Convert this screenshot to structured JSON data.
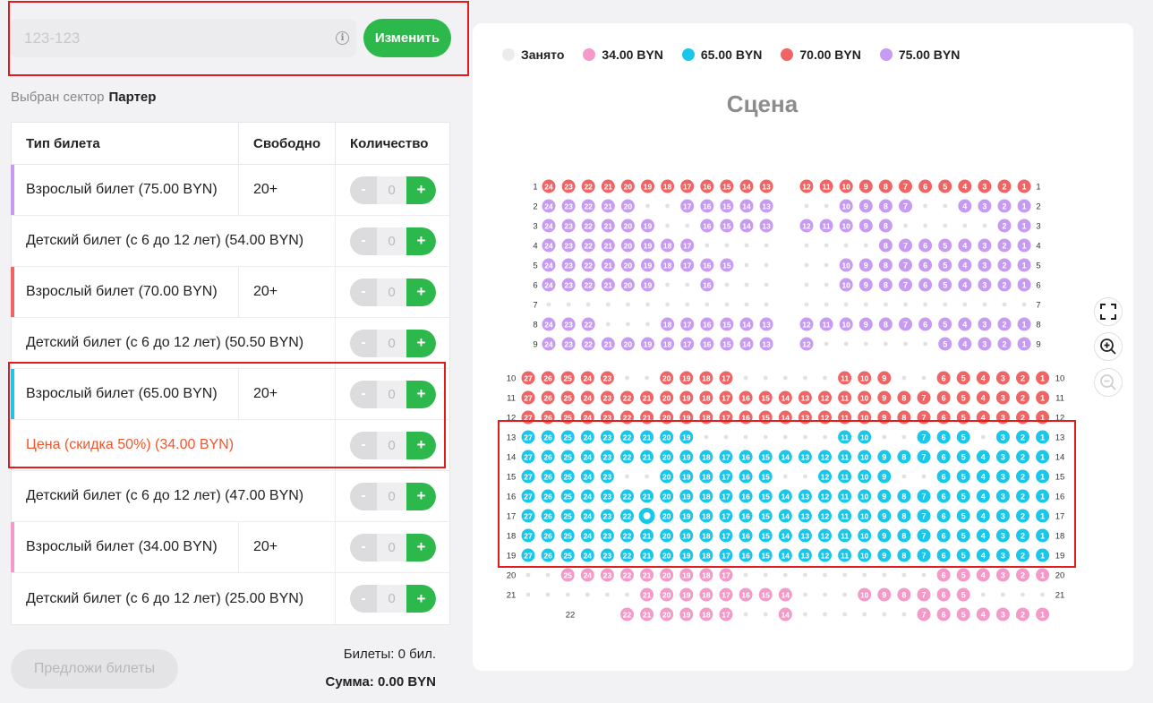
{
  "code_input": {
    "placeholder": "123-123",
    "value": ""
  },
  "change_button": "Изменить",
  "sector": {
    "label": "Выбран сектор",
    "value": "Партер"
  },
  "table": {
    "headers": {
      "type": "Тип билета",
      "free": "Свободно",
      "qty": "Количество"
    },
    "rows": [
      {
        "label": "Взрослый билет (75.00 BYN)",
        "free": "20+",
        "qty": "0",
        "kind": "main",
        "accent": "#c79bf2"
      },
      {
        "label": "Детский билет (с 6 до 12 лет) (54.00 BYN)",
        "qty": "0",
        "kind": "sub"
      },
      {
        "label": "Взрослый билет (70.00 BYN)",
        "free": "20+",
        "qty": "0",
        "kind": "main",
        "accent": "#f06464"
      },
      {
        "label": "Детский билет (с 6 до 12 лет) (50.50 BYN)",
        "qty": "0",
        "kind": "sub"
      },
      {
        "label": "Взрослый билет (65.00 BYN)",
        "free": "20+",
        "qty": "0",
        "kind": "main",
        "accent": "#19c7ea"
      },
      {
        "label": "Цена (скидка 50%) (34.00 BYN)",
        "qty": "0",
        "kind": "sub",
        "discount": true
      },
      {
        "label": "Детский билет (с 6 до 12 лет) (47.00 BYN)",
        "qty": "0",
        "kind": "sub"
      },
      {
        "label": "Взрослый билет (34.00 BYN)",
        "free": "20+",
        "qty": "0",
        "kind": "main",
        "accent": "#f49ac9"
      },
      {
        "label": "Детский билет (с 6 до 12 лет) (25.00 BYN)",
        "qty": "0",
        "kind": "sub"
      }
    ],
    "minus": "-",
    "plus": "+"
  },
  "offer_button": "Предложи билеты",
  "summary": {
    "tickets": "Билеты: 0 бил.",
    "sum": "Сумма: 0.00 BYN"
  },
  "legend": [
    {
      "label": "Занято",
      "color": "#ececee"
    },
    {
      "label": "34.00 BYN",
      "color": "#f49ac9"
    },
    {
      "label": "65.00 BYN",
      "color": "#19c7ea"
    },
    {
      "label": "70.00 BYN",
      "color": "#f06464"
    },
    {
      "label": "75.00 BYN",
      "color": "#c79bf2"
    }
  ],
  "stage": "Сцена",
  "colors": {
    "taken": "#e2e2e4",
    "purple": "#c79bf2",
    "red": "#f06464",
    "cyan": "#19c7ea",
    "pink": "#f49ac9",
    "green": "#2db84c"
  },
  "tools": {
    "fullscreen": "fullscreen-icon",
    "zoom_in": "zoom-in-icon",
    "zoom_out": "zoom-out-icon"
  },
  "seat_map": {
    "rows": [
      {
        "row": "1",
        "color": "purple",
        "sold_prefix": "",
        "left": [
          24,
          23,
          22,
          21,
          20,
          19,
          18,
          17,
          16,
          15,
          14,
          13
        ],
        "left_taken": [],
        "left_color": "red",
        "right": [
          12,
          11,
          10,
          9,
          8,
          7,
          6,
          5,
          4,
          3,
          2,
          1
        ],
        "right_taken": [],
        "right_color": "red"
      },
      {
        "row": "2",
        "left": [
          24,
          23,
          22,
          21,
          20,
          17,
          16,
          15,
          14,
          13
        ],
        "left_taken": [
          19,
          18
        ],
        "right": [
          10,
          9,
          8,
          7,
          4,
          3,
          2,
          1
        ],
        "right_taken": [
          12,
          11,
          6,
          5
        ],
        "color": "purple"
      },
      {
        "row": "3",
        "left": [
          24,
          23,
          22,
          21,
          20,
          19,
          16,
          15,
          14,
          13
        ],
        "left_taken": [
          18,
          17
        ],
        "right": [
          12,
          11,
          10,
          9,
          8,
          2,
          1
        ],
        "right_taken": [
          7,
          6,
          5,
          4,
          3
        ],
        "color": "purple"
      },
      {
        "row": "4",
        "left": [
          24,
          23,
          22,
          21,
          20,
          19,
          18,
          17
        ],
        "left_taken": [
          16,
          15,
          14,
          13
        ],
        "right": [
          8,
          7,
          6,
          5,
          4,
          3,
          2,
          1
        ],
        "right_taken": [
          12,
          11,
          10,
          9
        ],
        "color": "purple"
      },
      {
        "row": "5",
        "left": [
          24,
          23,
          22,
          21,
          20,
          19,
          18,
          17,
          16,
          15
        ],
        "left_taken": [
          14,
          13
        ],
        "right": [
          10,
          9,
          8,
          7,
          6,
          5,
          4,
          3,
          2,
          1
        ],
        "right_taken": [
          12,
          11
        ],
        "color": "purple"
      },
      {
        "row": "6",
        "left": [
          24,
          23,
          22,
          21,
          20,
          19,
          16
        ],
        "left_taken": [
          18,
          17,
          15,
          14,
          13
        ],
        "right": [
          10,
          9,
          8,
          7,
          6,
          5,
          4,
          3,
          2,
          1
        ],
        "right_taken": [
          12,
          11
        ],
        "color": "purple"
      },
      {
        "row": "7",
        "left": [],
        "left_taken": [
          24,
          23,
          22,
          21,
          20,
          19,
          18,
          17,
          16,
          15,
          14,
          13
        ],
        "right": [],
        "right_taken": [
          12,
          11,
          10,
          9,
          8,
          7,
          6,
          5,
          4,
          3,
          2,
          1
        ],
        "color": "purple"
      },
      {
        "row": "8",
        "left": [
          24,
          23,
          22,
          18,
          17,
          16,
          15,
          14,
          13
        ],
        "left_taken": [
          21,
          20,
          19
        ],
        "right": [
          12,
          11,
          10,
          9,
          8,
          7,
          6,
          5,
          4,
          3,
          2,
          1
        ],
        "right_taken": [],
        "color": "purple"
      },
      {
        "row": "9",
        "left": [
          24,
          23,
          22,
          21,
          20,
          19,
          18,
          17,
          16,
          15,
          14,
          13
        ],
        "left_taken": [],
        "right": [
          12,
          5,
          4,
          3,
          2,
          1
        ],
        "right_taken": [
          11,
          10,
          9,
          8,
          7,
          6
        ],
        "color": "purple"
      }
    ],
    "rows_red": [
      {
        "row": "10",
        "seats": [
          27,
          26,
          25,
          24,
          23,
          20,
          19,
          18,
          17,
          11,
          10,
          9,
          6,
          5,
          4,
          3,
          2,
          1
        ]
      },
      {
        "row": "11",
        "seats": [
          27,
          26,
          25,
          24,
          23,
          22,
          21,
          20,
          19,
          18,
          17,
          16,
          15,
          14,
          13,
          12,
          11,
          10,
          9,
          8,
          7,
          6,
          5,
          4,
          3,
          2,
          1
        ]
      },
      {
        "row": "12",
        "seats": [
          27,
          26,
          25,
          24,
          23,
          22,
          21,
          20,
          19,
          18,
          17,
          16,
          15,
          14,
          13,
          12,
          11,
          10,
          9,
          8,
          7,
          6,
          5,
          4,
          3,
          2,
          1
        ]
      }
    ],
    "rows_cyan": [
      {
        "row": "13",
        "seats": [
          27,
          26,
          25,
          24,
          23,
          22,
          21,
          20,
          19,
          11,
          10,
          7,
          6,
          5,
          3,
          2,
          1
        ]
      },
      {
        "row": "14",
        "seats": [
          27,
          26,
          25,
          24,
          23,
          22,
          21,
          20,
          19,
          18,
          17,
          16,
          15,
          14,
          13,
          12,
          11,
          10,
          9,
          8,
          7,
          6,
          5,
          4,
          3,
          2,
          1
        ]
      },
      {
        "row": "15",
        "seats": [
          27,
          26,
          25,
          24,
          23,
          20,
          19,
          18,
          17,
          16,
          15,
          12,
          11,
          10,
          9,
          6,
          5,
          4,
          3,
          2,
          1
        ]
      },
      {
        "row": "16",
        "seats": [
          27,
          26,
          25,
          24,
          23,
          22,
          21,
          20,
          19,
          18,
          17,
          16,
          15,
          14,
          13,
          12,
          11,
          10,
          9,
          8,
          7,
          6,
          5,
          4,
          3,
          2,
          1
        ]
      },
      {
        "row": "17",
        "seats": [
          27,
          26,
          25,
          24,
          23,
          22,
          21,
          20,
          19,
          18,
          17,
          16,
          15,
          14,
          13,
          12,
          11,
          10,
          9,
          8,
          7,
          6,
          5,
          4,
          3,
          2,
          1
        ]
      },
      {
        "row": "18",
        "seats": [
          27,
          26,
          25,
          24,
          23,
          22,
          21,
          20,
          19,
          18,
          17,
          16,
          15,
          14,
          13,
          12,
          11,
          10,
          9,
          8,
          7,
          6,
          5,
          4,
          3,
          2,
          1
        ]
      },
      {
        "row": "19",
        "seats": [
          27,
          26,
          25,
          24,
          23,
          22,
          21,
          20,
          19,
          18,
          17,
          16,
          15,
          14,
          13,
          12,
          11,
          10,
          9,
          8,
          7,
          6,
          5,
          4,
          3,
          2,
          1
        ]
      }
    ],
    "rows_pink": [
      {
        "row": "20",
        "seats": [
          25,
          24,
          23,
          22,
          21,
          20,
          19,
          18,
          17,
          6,
          5,
          4,
          3,
          2,
          1
        ]
      },
      {
        "row": "21",
        "seats": [
          21,
          20,
          19,
          18,
          17,
          16,
          15,
          14,
          10,
          9,
          8,
          7,
          6,
          5
        ]
      },
      {
        "row": "22",
        "seats": [
          22,
          21,
          20,
          19,
          18,
          17,
          14,
          7,
          6,
          5,
          4,
          3,
          2,
          1
        ]
      }
    ],
    "selected_seat": {
      "row": "17",
      "seat": "21"
    }
  }
}
